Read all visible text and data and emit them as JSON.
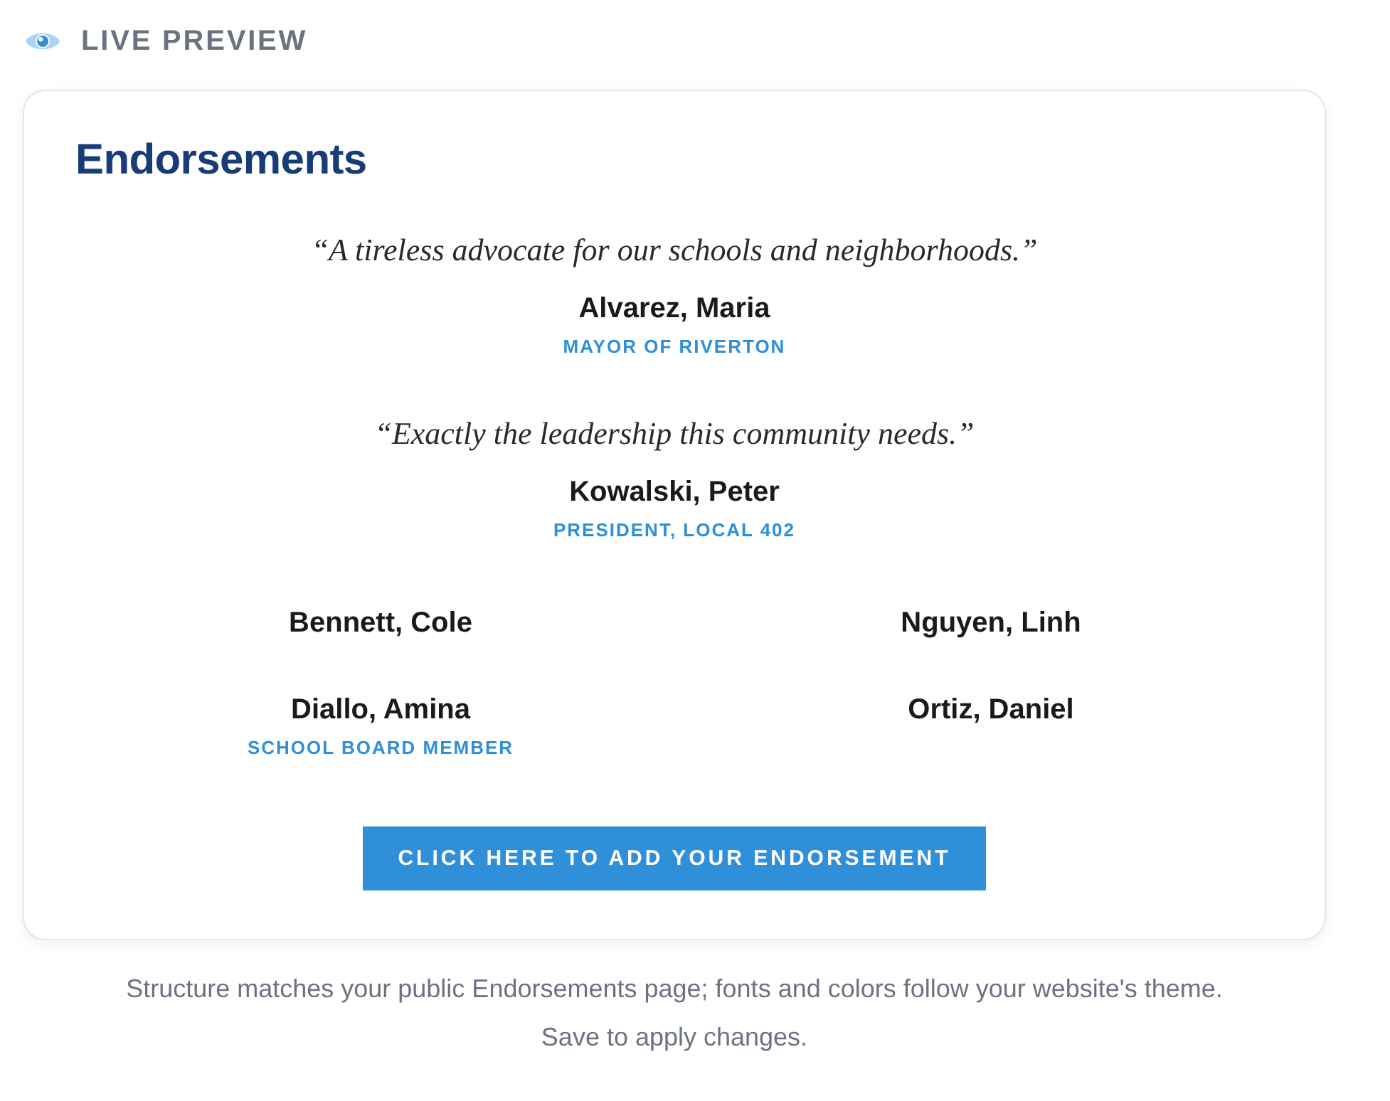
{
  "header": {
    "label": "LIVE PREVIEW"
  },
  "card": {
    "heading": "Endorsements",
    "featured": [
      {
        "quote": "“A tireless advocate for our schools and neighborhoods.”",
        "name": "Alvarez, Maria",
        "title": "MAYOR OF RIVERTON"
      },
      {
        "quote": "“Exactly the leadership this community needs.”",
        "name": "Kowalski, Peter",
        "title": "PRESIDENT, LOCAL 402"
      }
    ],
    "endorsers": [
      {
        "name": "Bennett, Cole"
      },
      {
        "name": "Nguyen, Linh"
      },
      {
        "name": "Diallo, Amina",
        "title": "SCHOOL BOARD MEMBER"
      },
      {
        "name": "Ortiz, Daniel"
      }
    ],
    "button": "CLICK HERE TO ADD YOUR ENDORSEMENT"
  },
  "note": "Structure matches your public Endorsements page; fonts and colors follow your website's theme. Save to apply changes."
}
